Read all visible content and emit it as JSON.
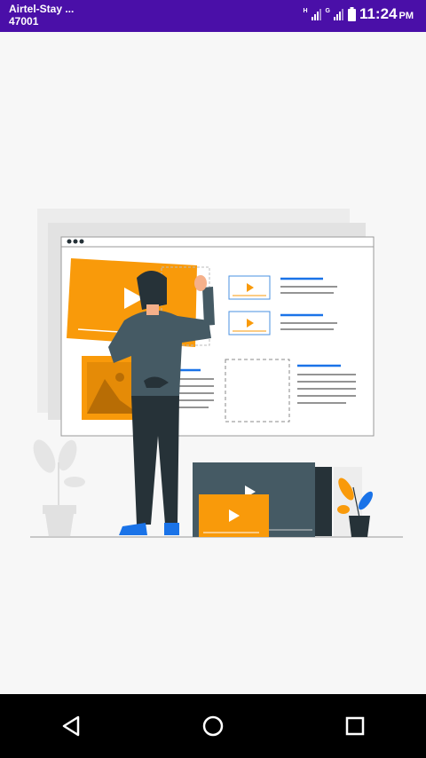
{
  "status_bar": {
    "carrier_line1": "Airtel-Stay ...",
    "carrier_line2": "47001",
    "network_type_1": "H",
    "network_type_2": "G",
    "time": "11:24",
    "ampm": "PM",
    "background_color": "#4a0fa8"
  },
  "illustration": {
    "description_icon": "video-content-creator-illustration",
    "accent_color": "#f99a0a",
    "dark_color": "#3b4046",
    "blue_color": "#1a73e8"
  },
  "navigation_bar": {
    "back_icon": "back-triangle-icon",
    "home_icon": "home-circle-icon",
    "recents_icon": "recents-square-icon"
  }
}
